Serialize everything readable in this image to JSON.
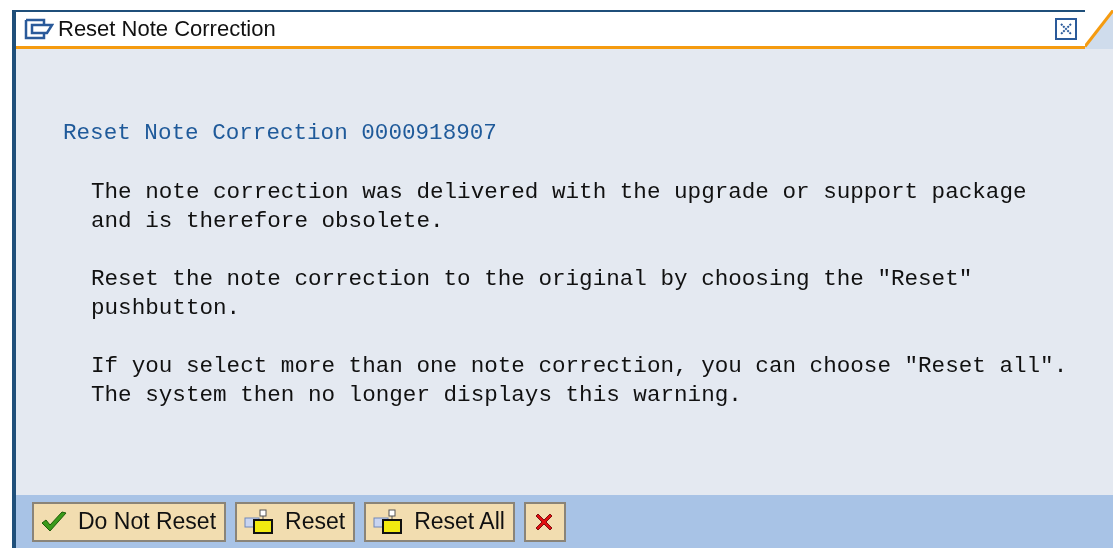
{
  "window": {
    "title": "Reset Note Correction"
  },
  "message": {
    "heading": "Reset Note Correction 0000918907",
    "paragraphs": [
      "The note correction was delivered with the upgrade or support package\nand is therefore obsolete.",
      "Reset the note correction to the original by choosing the \"Reset\"\npushbutton.",
      "If you select more than one note correction, you can choose \"Reset all\".\nThe system then no longer displays this warning."
    ]
  },
  "buttons": [
    {
      "kind": "confirm",
      "label": "Do Not Reset"
    },
    {
      "kind": "reset",
      "label": "Reset"
    },
    {
      "kind": "reset",
      "label": "Reset All"
    },
    {
      "kind": "cancel"
    }
  ]
}
